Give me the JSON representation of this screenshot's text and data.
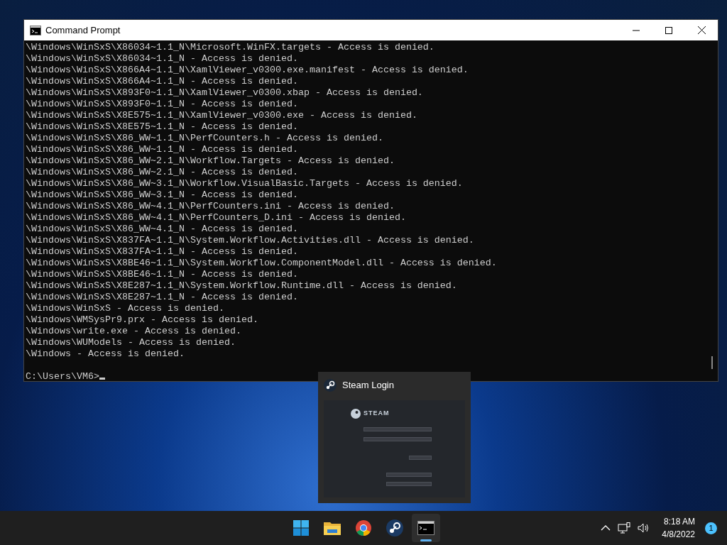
{
  "window": {
    "title": "Command Prompt"
  },
  "console": {
    "lines": [
      "\\Windows\\WinSxS\\X86034~1.1_N\\Microsoft.WinFX.targets - Access is denied.",
      "\\Windows\\WinSxS\\X86034~1.1_N - Access is denied.",
      "\\Windows\\WinSxS\\X866A4~1.1_N\\XamlViewer_v0300.exe.manifest - Access is denied.",
      "\\Windows\\WinSxS\\X866A4~1.1_N - Access is denied.",
      "\\Windows\\WinSxS\\X893F0~1.1_N\\XamlViewer_v0300.xbap - Access is denied.",
      "\\Windows\\WinSxS\\X893F0~1.1_N - Access is denied.",
      "\\Windows\\WinSxS\\X8E575~1.1_N\\XamlViewer_v0300.exe - Access is denied.",
      "\\Windows\\WinSxS\\X8E575~1.1_N - Access is denied.",
      "\\Windows\\WinSxS\\X86_WW~1.1_N\\PerfCounters.h - Access is denied.",
      "\\Windows\\WinSxS\\X86_WW~1.1_N - Access is denied.",
      "\\Windows\\WinSxS\\X86_WW~2.1_N\\Workflow.Targets - Access is denied.",
      "\\Windows\\WinSxS\\X86_WW~2.1_N - Access is denied.",
      "\\Windows\\WinSxS\\X86_WW~3.1_N\\Workflow.VisualBasic.Targets - Access is denied.",
      "\\Windows\\WinSxS\\X86_WW~3.1_N - Access is denied.",
      "\\Windows\\WinSxS\\X86_WW~4.1_N\\PerfCounters.ini - Access is denied.",
      "\\Windows\\WinSxS\\X86_WW~4.1_N\\PerfCounters_D.ini - Access is denied.",
      "\\Windows\\WinSxS\\X86_WW~4.1_N - Access is denied.",
      "\\Windows\\WinSxS\\X837FA~1.1_N\\System.Workflow.Activities.dll - Access is denied.",
      "\\Windows\\WinSxS\\X837FA~1.1_N - Access is denied.",
      "\\Windows\\WinSxS\\X8BE46~1.1_N\\System.Workflow.ComponentModel.dll - Access is denied.",
      "\\Windows\\WinSxS\\X8BE46~1.1_N - Access is denied.",
      "\\Windows\\WinSxS\\X8E287~1.1_N\\System.Workflow.Runtime.dll - Access is denied.",
      "\\Windows\\WinSxS\\X8E287~1.1_N - Access is denied.",
      "\\Windows\\WinSxS - Access is denied.",
      "\\Windows\\WMSysPr9.prx - Access is denied.",
      "\\Windows\\write.exe - Access is denied.",
      "\\Windows\\WUModels - Access is denied.",
      "\\Windows - Access is denied."
    ],
    "prompt": "C:\\Users\\VM6>"
  },
  "preview": {
    "title": "Steam Login",
    "thumbnail_logo": "STEAM"
  },
  "taskbar": {
    "apps": [
      {
        "kind": "start",
        "selected": false
      },
      {
        "kind": "folder",
        "selected": false
      },
      {
        "kind": "browser",
        "selected": false
      },
      {
        "kind": "steam",
        "selected": false
      },
      {
        "kind": "terminal",
        "selected": true
      }
    ]
  },
  "tray": {
    "time": "8:18 AM",
    "date": "4/8/2022",
    "notifications": "1"
  }
}
